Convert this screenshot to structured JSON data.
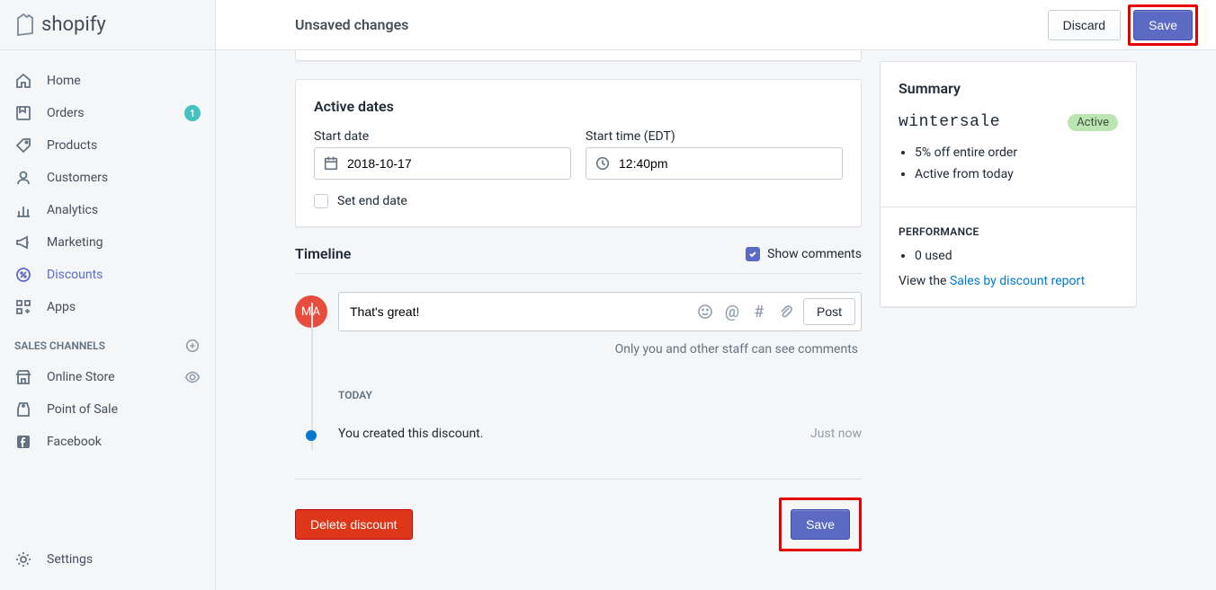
{
  "brand": "shopify",
  "header": {
    "title": "Unsaved changes",
    "discard": "Discard",
    "save": "Save"
  },
  "nav": {
    "primary": [
      {
        "label": "Home"
      },
      {
        "label": "Orders",
        "badge": "1"
      },
      {
        "label": "Products"
      },
      {
        "label": "Customers"
      },
      {
        "label": "Analytics"
      },
      {
        "label": "Marketing"
      },
      {
        "label": "Discounts",
        "active": true
      },
      {
        "label": "Apps"
      }
    ],
    "channels_title": "SALES CHANNELS",
    "channels": [
      {
        "label": "Online Store"
      },
      {
        "label": "Point of Sale"
      },
      {
        "label": "Facebook"
      }
    ],
    "settings": "Settings"
  },
  "dates": {
    "title": "Active dates",
    "start_date_label": "Start date",
    "start_date": "2018-10-17",
    "start_time_label": "Start time (EDT)",
    "start_time": "12:40pm",
    "set_end": "Set end date"
  },
  "timeline": {
    "title": "Timeline",
    "show_comments": "Show comments",
    "avatar_initials": "MA",
    "comment_text": "That's great!",
    "post": "Post",
    "hint": "Only you and other staff can see comments",
    "day": "TODAY",
    "event_text": "You created this discount.",
    "event_time": "Just now"
  },
  "summary": {
    "title": "Summary",
    "name": "wintersale",
    "status": "Active",
    "bullets": [
      "5% off entire order",
      "Active from today"
    ],
    "perf_title": "PERFORMANCE",
    "perf_bullet": "0 used",
    "view_prefix": "View the ",
    "view_link": "Sales by discount report"
  },
  "footer": {
    "delete": "Delete discount",
    "save": "Save"
  }
}
